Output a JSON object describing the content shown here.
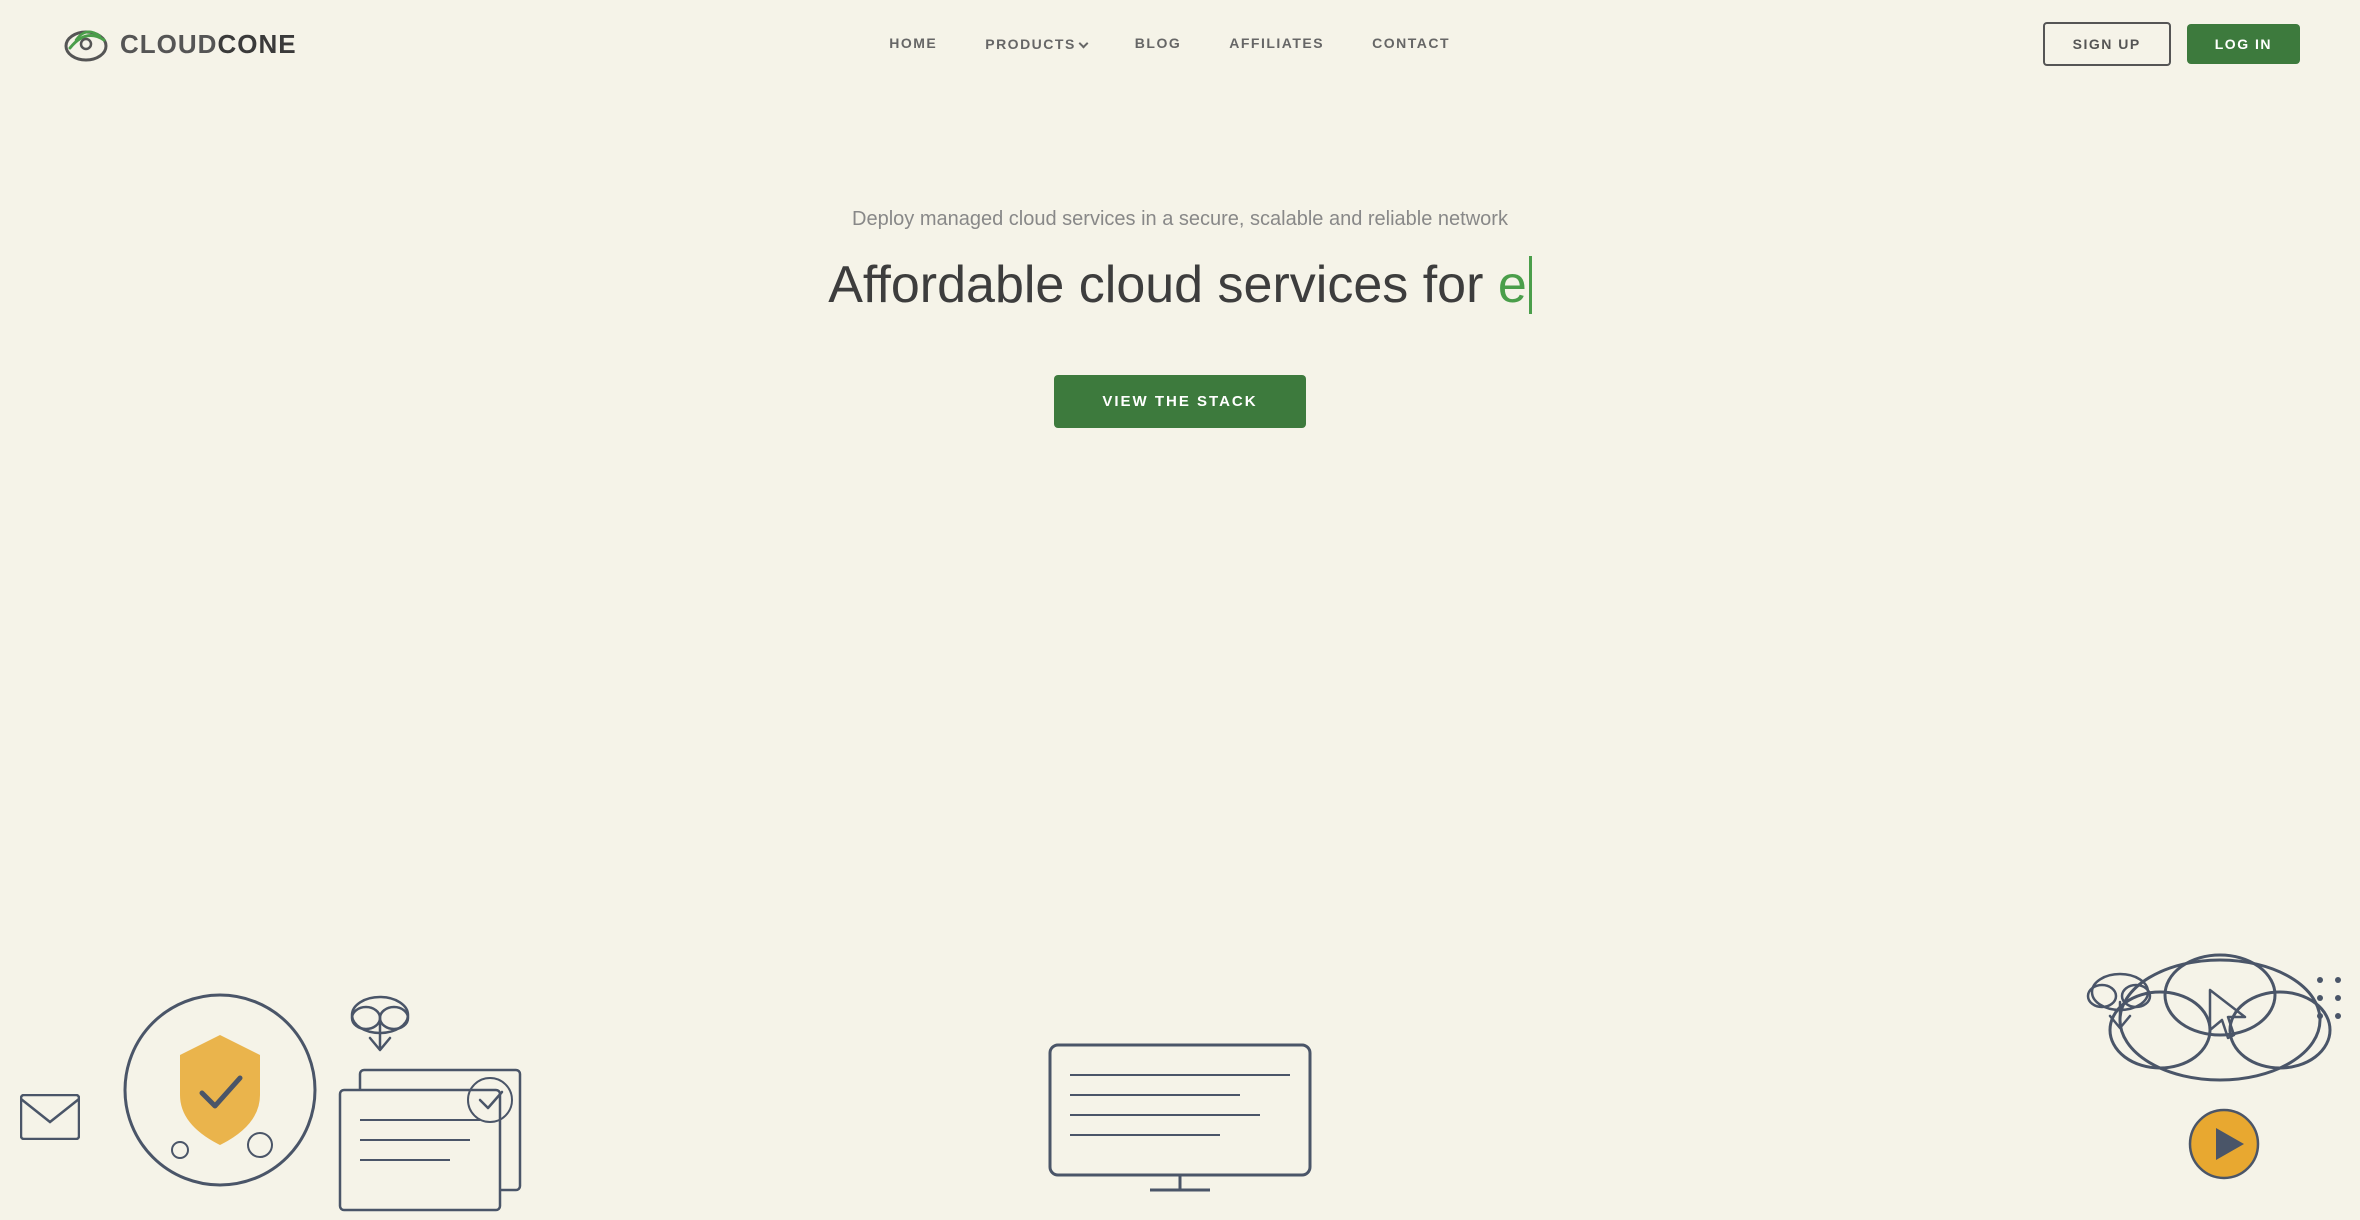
{
  "brand": {
    "name_cloud": "CLOUD",
    "name_cone": "CONE"
  },
  "nav": {
    "links": [
      {
        "id": "home",
        "label": "HOME"
      },
      {
        "id": "products",
        "label": "PRODUCTS",
        "has_dropdown": true
      },
      {
        "id": "blog",
        "label": "BLOG"
      },
      {
        "id": "affiliates",
        "label": "AFFILIATES"
      },
      {
        "id": "contact",
        "label": "CONTACT"
      }
    ],
    "signup_label": "SIGN UP",
    "login_label": "LOG IN"
  },
  "hero": {
    "subtitle": "Deploy managed cloud services in a secure, scalable and reliable network",
    "title_prefix": "Affordable cloud services for ",
    "title_typing": "e",
    "cta_label": "VIEW THE STACK"
  },
  "colors": {
    "background": "#f5f3e8",
    "green": "#3d7a3d",
    "green_light": "#4a9e4a",
    "text_dark": "#3d3d3d",
    "text_muted": "#888",
    "text_nav": "#666",
    "shield_yellow": "#e8a830",
    "play_yellow": "#e8a830",
    "illustration_stroke": "#4a5568"
  }
}
